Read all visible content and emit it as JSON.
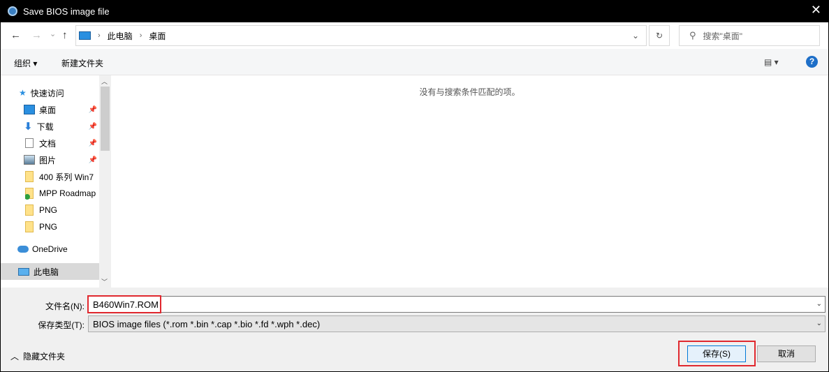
{
  "window": {
    "title": "Save BIOS image file",
    "close": "✕"
  },
  "nav": {
    "back": "←",
    "forward": "→",
    "recent": "⌄",
    "up": "↑",
    "breadcrumb": [
      "此电脑",
      "桌面"
    ],
    "refresh": "↻",
    "search_placeholder": "搜索\"桌面\""
  },
  "toolbar": {
    "organize": "组织 ▾",
    "new_folder": "新建文件夹",
    "view": "▤ ▾",
    "help": "?"
  },
  "sidebar": {
    "items": [
      {
        "label": "快速访问",
        "icon": "star-icon"
      },
      {
        "label": "桌面",
        "icon": "desktop-icon",
        "pinned": true
      },
      {
        "label": "下载",
        "icon": "download-icon",
        "pinned": true
      },
      {
        "label": "文档",
        "icon": "document-icon",
        "pinned": true
      },
      {
        "label": "图片",
        "icon": "picture-icon",
        "pinned": true
      },
      {
        "label": "400 系列 Win7",
        "icon": "folder-icon"
      },
      {
        "label": "MPP Roadmap",
        "icon": "folder-synced-icon"
      },
      {
        "label": "PNG",
        "icon": "folder-icon"
      },
      {
        "label": "PNG",
        "icon": "folder-icon"
      },
      {
        "label": "OneDrive",
        "icon": "onedrive-icon"
      },
      {
        "label": "此电脑",
        "icon": "pc-icon",
        "selected": true
      }
    ]
  },
  "content": {
    "empty_message": "没有与搜索条件匹配的项。"
  },
  "form": {
    "filename_label": "文件名(N):",
    "filename_value": "B460Win7.ROM",
    "filetype_label": "保存类型(T):",
    "filetype_value": "BIOS image files (*.rom *.bin *.cap *.bio *.fd *.wph *.dec)"
  },
  "footer": {
    "hide_folders": "隐藏文件夹",
    "save": "保存(S)",
    "cancel": "取消"
  },
  "colors": {
    "highlight": "#e0282e",
    "accent": "#0078d7"
  }
}
